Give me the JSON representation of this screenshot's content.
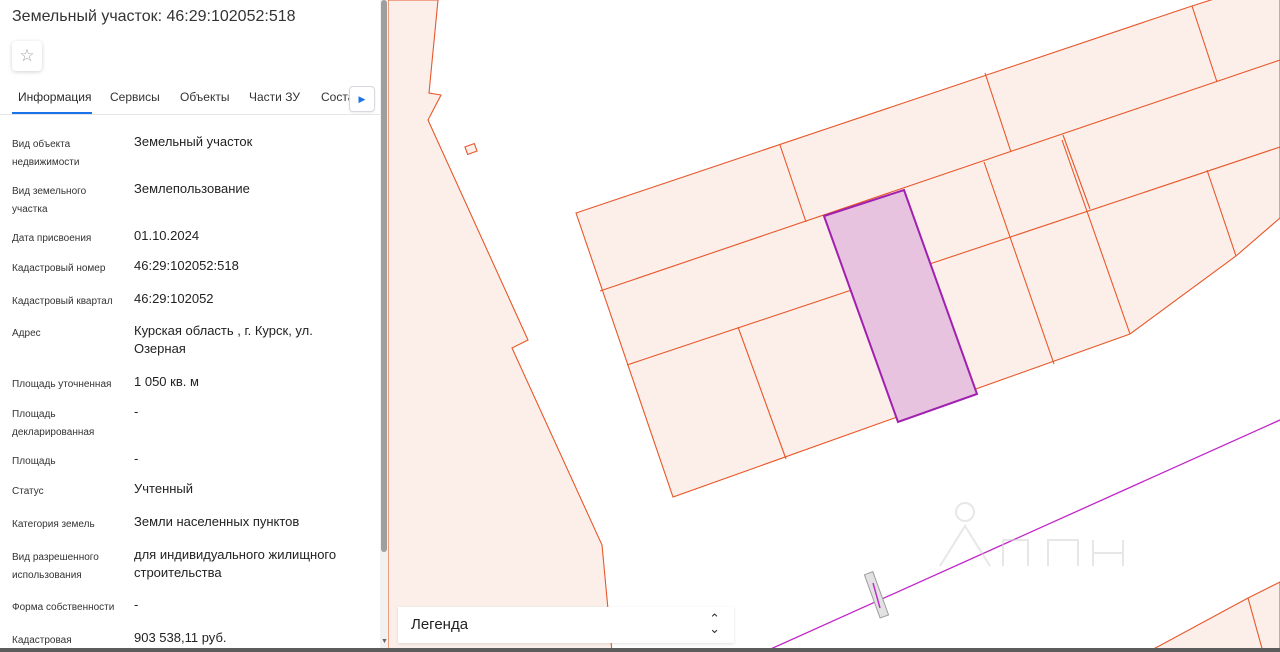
{
  "header": {
    "title": "Земельный участок: 46:29:102052:518"
  },
  "tabs": [
    {
      "label": "Информация"
    },
    {
      "label": "Сервисы"
    },
    {
      "label": "Объекты"
    },
    {
      "label": "Части ЗУ"
    },
    {
      "label": "Соста"
    }
  ],
  "properties": [
    {
      "label": "Вид объекта недвижимости",
      "value": "Земельный участок"
    },
    {
      "label": "Вид земельного участка",
      "value": "Землепользование"
    },
    {
      "label": "Дата присвоения",
      "value": "01.10.2024"
    },
    {
      "label": "Кадастровый номер",
      "value": "46:29:102052:518"
    },
    {
      "label": "Кадастровый квартал",
      "value": "46:29:102052"
    },
    {
      "label": "Адрес",
      "value": "Курская область , г. Курск, ул. Озерная"
    },
    {
      "label": "Площадь уточненная",
      "value": "1 050 кв. м"
    },
    {
      "label": "Площадь декларированная",
      "value": "-"
    },
    {
      "label": "Площадь",
      "value": "-"
    },
    {
      "label": "Статус",
      "value": "Учтенный"
    },
    {
      "label": "Категория земель",
      "value": "Земли населенных пунктов"
    },
    {
      "label": "Вид разрешенного использования",
      "value": "для индивидуального жилищного строительства"
    },
    {
      "label": "Форма собственности",
      "value": "-"
    },
    {
      "label": "Кадастровая",
      "value": "903 538,11 руб."
    }
  ],
  "legend": {
    "label": "Легенда"
  },
  "icons": {
    "favorite": "star-outline-icon",
    "tabs_scroll": "chevron-right-icon",
    "legend_toggle": "chevron-up-down-icon"
  },
  "colors": {
    "parcel_fill": "#fcefe9",
    "parcel_stroke": "#e8572a",
    "selected_fill": "#e8c3df",
    "selected_stroke": "#a020b0",
    "accent": "#1a73e8"
  }
}
